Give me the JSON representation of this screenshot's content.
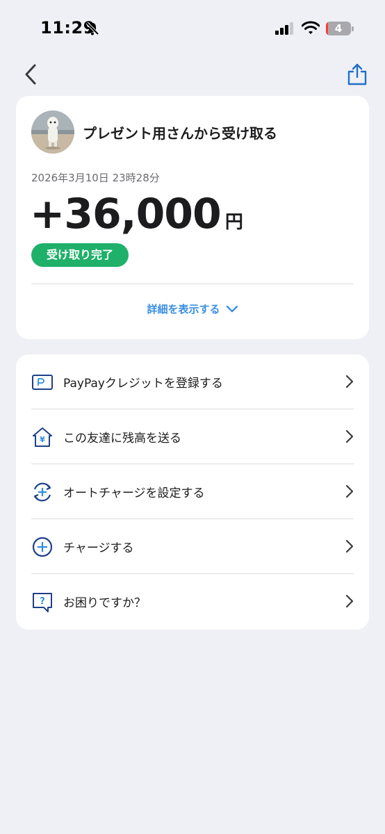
{
  "status_bar": {
    "time": "11:29",
    "battery_level": "4",
    "battery_fraction": 0.04
  },
  "nav": {
    "back_icon": "chevron-left-icon",
    "share_icon": "share-icon"
  },
  "transaction": {
    "title": "プレゼント用さんから受け取る",
    "date": "2026年3月10日 23時28分",
    "amount": "+36,000",
    "currency_unit": "円",
    "status": "受け取り完了",
    "details_toggle": "詳細を表示する"
  },
  "menu": {
    "items": [
      {
        "label": "PayPayクレジットを登録する",
        "icon": "credit-card-icon"
      },
      {
        "label": "この友達に残高を送る",
        "icon": "yen-house-icon"
      },
      {
        "label": "オートチャージを設定する",
        "icon": "auto-charge-icon"
      },
      {
        "label": "チャージする",
        "icon": "plus-circle-icon"
      },
      {
        "label": "お困りですか？",
        "icon": "help-bubble-icon"
      }
    ]
  },
  "colors": {
    "background": "#eff0f5",
    "status_green": "#1fb06a",
    "link_blue": "#3c8fe2",
    "icon_navy": "#1e3f8a"
  }
}
